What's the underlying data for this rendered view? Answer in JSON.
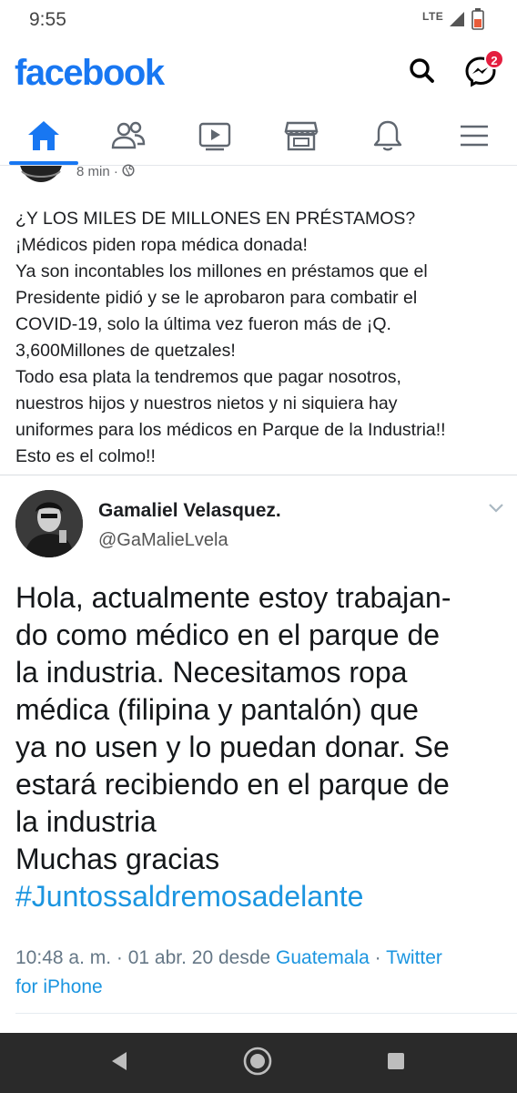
{
  "status_bar": {
    "time": "9:55",
    "network": "LTE"
  },
  "app": {
    "logo": "facebook",
    "messenger_badge": "2"
  },
  "nav": {
    "tabs": [
      {
        "name": "home",
        "icon": "home-icon",
        "active": true
      },
      {
        "name": "friends",
        "icon": "friends-icon"
      },
      {
        "name": "watch",
        "icon": "watch-icon"
      },
      {
        "name": "marketplace",
        "icon": "marketplace-icon"
      },
      {
        "name": "notifications",
        "icon": "bell-icon"
      },
      {
        "name": "menu",
        "icon": "menu-icon"
      }
    ]
  },
  "post": {
    "time": "8 min · ",
    "lines": [
      "¿Y LOS MILES DE MILLONES EN PRÉSTAMOS?",
      "¡Médicos piden ropa médica donada!",
      "Ya son incontables los millones en préstamos que el",
      "Presidente pidió y se le aprobaron para combatir el",
      "COVID-19, solo la última vez fueron más de ¡Q.",
      "3,600Millones de quetzales!",
      "Todo esa plata la tendremos que pagar nosotros,",
      "nuestros hijos y nuestros nietos y ni siquiera hay",
      "uniformes para los médicos en Parque de la Industria!!",
      "Esto es el colmo!!"
    ]
  },
  "tweet": {
    "name": "Gamaliel Velasquez.",
    "handle": "@GaMalieLvela",
    "lines": [
      "Hola, actualmente estoy trabajan-",
      "do como médico en el parque de",
      "la industria. Necesitamos ropa",
      "médica (filipina y pantalón)  que",
      "ya no usen y lo puedan donar. Se",
      "estará recibiendo en el parque de",
      "la industria",
      "Muchas gracias"
    ],
    "hashtag": "#Juntossaldremosadelante",
    "meta_time": "10:48 a. m. · 01 abr. 20 desde ",
    "meta_location": "Guatemala",
    "meta_sep": " · ",
    "meta_source_1": "Twitter",
    "meta_source_2": "for iPhone"
  },
  "colors": {
    "brand": "#1877f2",
    "twitter_link": "#1b95e0",
    "badge": "#e41e3f"
  }
}
